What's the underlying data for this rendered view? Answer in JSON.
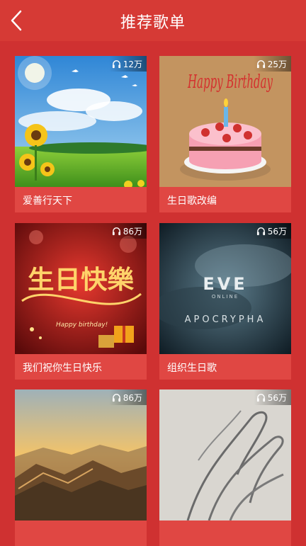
{
  "header": {
    "title": "推荐歌单"
  },
  "playlists": [
    {
      "name": "爱善行天下",
      "plays": "12万"
    },
    {
      "name": "生日歌改编",
      "plays": "25万"
    },
    {
      "name": "我们祝你生日快乐",
      "plays": "86万"
    },
    {
      "name": "组织生日歌",
      "plays": "56万"
    },
    {
      "name": "",
      "plays": "86万"
    },
    {
      "name": "",
      "plays": "56万"
    }
  ],
  "cover_text": {
    "happy_birthday": "Happy Birthday",
    "shengri_kuaile": "生日快樂",
    "small_greeting": "Happy birthday!",
    "eve_logo": "EVE",
    "eve_sub": "ONLINE",
    "apocrypha": "APOCRYPHA"
  },
  "colors": {
    "background": "#cf3131",
    "header": "#d63a35",
    "card": "#e04743"
  }
}
